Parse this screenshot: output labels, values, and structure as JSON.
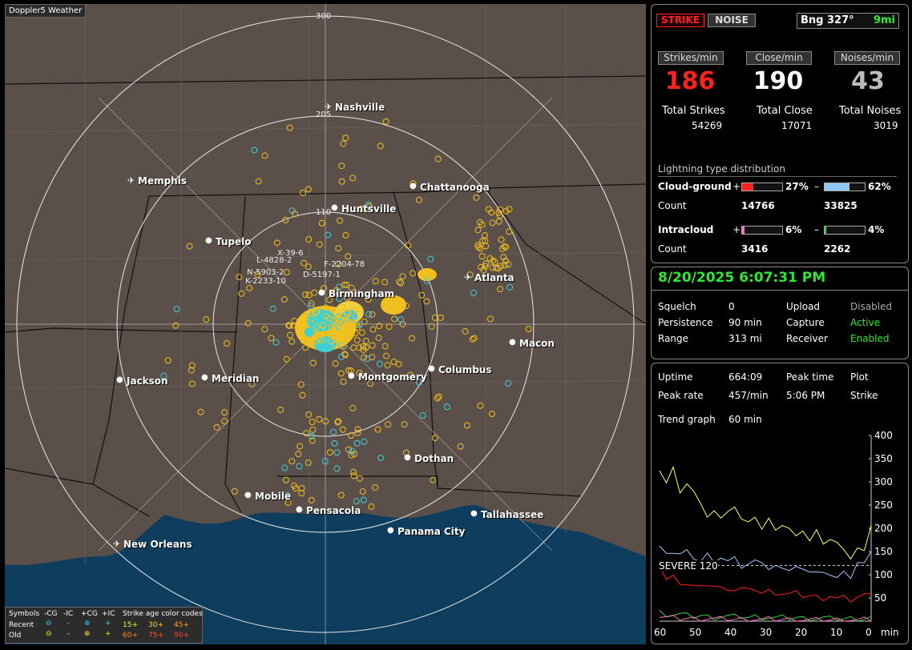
{
  "map": {
    "title": "Doppler5 Weather",
    "ring_labels": [
      "300",
      "205",
      "110"
    ],
    "cities": [
      {
        "name": "Nashville",
        "airport": true
      },
      {
        "name": "Memphis",
        "airport": true
      },
      {
        "name": "Chattanooga",
        "airport": false
      },
      {
        "name": "Huntsville",
        "airport": false
      },
      {
        "name": "Tupelo",
        "airport": false
      },
      {
        "name": "Atlanta",
        "airport": true
      },
      {
        "name": "Birmingham",
        "airport": false
      },
      {
        "name": "Macon",
        "airport": false
      },
      {
        "name": "Jackson",
        "airport": false
      },
      {
        "name": "Meridian",
        "airport": false
      },
      {
        "name": "Montgomery",
        "airport": false
      },
      {
        "name": "Columbus",
        "airport": false
      },
      {
        "name": "Dothan",
        "airport": false
      },
      {
        "name": "Mobile",
        "airport": false
      },
      {
        "name": "Pensacola",
        "airport": false
      },
      {
        "name": "Tallahassee",
        "airport": false
      },
      {
        "name": "Panama City",
        "airport": false
      },
      {
        "name": "New Orleans",
        "airport": true
      }
    ],
    "storm_labels": [
      "X-39-6",
      "L-4828-2",
      "F-2204-78",
      "N-5903-2",
      "K-2233-10",
      "D-5197-1"
    ]
  },
  "legend": {
    "header": [
      "Symbols",
      "-CG",
      "-IC",
      "+CG",
      "+IC",
      "Strike age color codes"
    ],
    "recent_label": "Recent",
    "old_label": "Old",
    "recent_codes": [
      "15+",
      "30+",
      "45+"
    ],
    "old_codes": [
      "60+",
      "75+",
      "90+"
    ]
  },
  "panel1": {
    "strike_btn": "STRIKE",
    "noise_btn": "NOISE",
    "bearing": "Bng 327°",
    "distance": "9mi",
    "rate_labels": [
      "Strikes/min",
      "Close/min",
      "Noises/min"
    ],
    "rates": [
      "186",
      "190",
      "43"
    ],
    "total_labels": [
      "Total Strikes",
      "Total Close",
      "Total Noises"
    ],
    "totals": [
      "54269",
      "17071",
      "3019"
    ],
    "dist_title": "Lightning type distribution",
    "cg_label": "Cloud-ground",
    "cg_pos_pct": "27%",
    "cg_neg_pct": "62%",
    "cg_pos_frac": 0.27,
    "cg_neg_frac": 0.62,
    "count_label": "Count",
    "cg_pos_count": "14766",
    "cg_neg_count": "33825",
    "ic_label": "Intracloud",
    "ic_pos_pct": "6%",
    "ic_neg_pct": "4%",
    "ic_pos_frac": 0.06,
    "ic_neg_frac": 0.04,
    "ic_pos_count": "3416",
    "ic_neg_count": "2262",
    "plus": "+",
    "minus": "–"
  },
  "panel2": {
    "datetime": "8/20/2025 6:07:31 PM",
    "rows": [
      [
        "Squelch",
        "0",
        "Upload",
        "Disabled"
      ],
      [
        "Persistence",
        "90 min",
        "Capture",
        "Active"
      ],
      [
        "Range",
        "313 mi",
        "Receiver",
        "Enabled"
      ]
    ]
  },
  "panel3": {
    "uptime_label": "Uptime",
    "uptime": "664:09",
    "peak_time_label": "Peak time",
    "peak_time": "5:06 PM",
    "plot_label": "Plot",
    "plot_value": "Strike",
    "peak_rate_label": "Peak rate",
    "peak_rate": "457/min",
    "trend_label": "Trend graph",
    "trend_value": "60 min",
    "severe_label": "SEVERE 120"
  },
  "colors": {
    "strike_red": "#ff2020",
    "close_white": "#ffffff",
    "noise_gray": "#bbbbbb",
    "cg_pos": "#ff2020",
    "cg_neg": "#8ec8f0",
    "ic_pos": "#e878c0",
    "ic_neg": "#30d030",
    "active_green": "#30e830"
  },
  "chart_data": {
    "type": "line",
    "x_ticks": [
      "60",
      "50",
      "40",
      "30",
      "20",
      "10",
      "0"
    ],
    "x_unit": "min",
    "y_ticks": [
      "400",
      "350",
      "300",
      "250",
      "200",
      "150",
      "100",
      "50"
    ],
    "xlim": [
      60,
      0
    ],
    "ylim": [
      0,
      400
    ],
    "series": [
      {
        "color": "#ffff60",
        "values": [
          330,
          300,
          330,
          270,
          300,
          280,
          250,
          230,
          240,
          220,
          230,
          250,
          220,
          210,
          230,
          200,
          220,
          190,
          210,
          200,
          180,
          200,
          175,
          195,
          160,
          180,
          170,
          150,
          140,
          160,
          150,
          200
        ]
      },
      {
        "color": "#a0c8ff",
        "values": [
          160,
          140,
          150,
          145,
          150,
          140,
          130,
          145,
          120,
          140,
          130,
          135,
          120,
          125,
          130,
          120,
          115,
          120,
          110,
          115,
          120,
          110,
          100,
          110,
          105,
          95,
          100,
          110,
          90,
          120,
          130,
          150
        ]
      },
      {
        "color": "#ff2020",
        "values": [
          120,
          90,
          95,
          85,
          80,
          75,
          70,
          80,
          75,
          70,
          72,
          68,
          70,
          65,
          70,
          60,
          65,
          62,
          60,
          58,
          60,
          55,
          55,
          52,
          50,
          55,
          48,
          50,
          45,
          52,
          55,
          65
        ]
      },
      {
        "color": "#40d040",
        "values": [
          20,
          15,
          14,
          15,
          12,
          10,
          12,
          10,
          9,
          10,
          11,
          9,
          10,
          8,
          10,
          9,
          8,
          7,
          8,
          7,
          8,
          6,
          7,
          6,
          7,
          5,
          6,
          5,
          6,
          5,
          6,
          8
        ]
      },
      {
        "color": "#ff70c0",
        "values": [
          10,
          8,
          7,
          6,
          6,
          5,
          5,
          6,
          5,
          4,
          5,
          4,
          4,
          5,
          4,
          3,
          4,
          3,
          4,
          3,
          3,
          3,
          3,
          2,
          3,
          2,
          3,
          2,
          3,
          2,
          3,
          4
        ]
      }
    ]
  }
}
